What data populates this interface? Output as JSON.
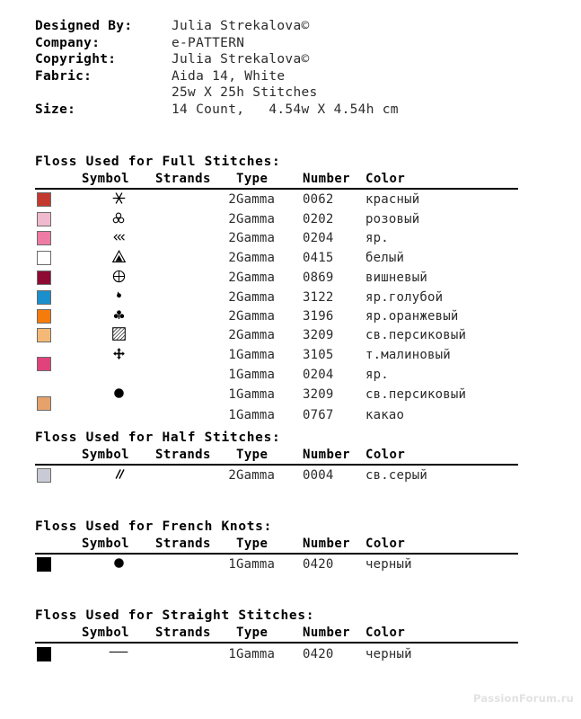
{
  "document": {
    "header": {
      "rows": [
        {
          "label": "Designed By:",
          "value": "Julia Strekalova©"
        },
        {
          "label": "Company:",
          "value": "e-PATTERN"
        },
        {
          "label": "Copyright:",
          "value": "Julia Strekalova©"
        },
        {
          "label": "Fabric:",
          "value": "Aida 14, White"
        },
        {
          "label": "",
          "value": "25w X 25h Stitches"
        },
        {
          "label": "Size:",
          "value": "14 Count,   4.54w X 4.54h cm"
        }
      ]
    },
    "columns": {
      "swatch": "",
      "symbol": "Symbol",
      "strands": "Strands",
      "type": "Type",
      "number": "Number",
      "color": "Color"
    },
    "sections": [
      {
        "id": "full-stitches",
        "title": "Floss Used for Full Stitches:",
        "rows": [
          {
            "swatch": "#C4392E",
            "symbol": "asterisk-six-icon",
            "strands": "2",
            "type": "Gamma",
            "number": "0062",
            "color": "красный"
          },
          {
            "swatch": "#EFB9CE",
            "symbol": "trefoil-icon",
            "strands": "2",
            "type": "Gamma",
            "number": "0202",
            "color": "розовый"
          },
          {
            "swatch": "#EE7BA3",
            "symbol": "triple-chevron-left-icon",
            "strands": "2",
            "type": "Gamma",
            "number": "0204",
            "color": "яр."
          },
          {
            "swatch": "#FFFFFF",
            "symbol": "triangle-nested-icon",
            "strands": "2",
            "type": "Gamma",
            "number": "0415",
            "color": "белый"
          },
          {
            "swatch": "#8E0B33",
            "symbol": "circled-plus-icon",
            "strands": "2",
            "type": "Gamma",
            "number": "0869",
            "color": "вишневый"
          },
          {
            "swatch": "#1B8FCC",
            "symbol": "comma-dot-icon",
            "strands": "2",
            "type": "Gamma",
            "number": "3122",
            "color": "яр.голубой"
          },
          {
            "swatch": "#F57C0A",
            "symbol": "club-filled-icon",
            "strands": "2",
            "type": "Gamma",
            "number": "3196",
            "color": "яр.оранжевый"
          },
          {
            "swatch": "#F5B977",
            "symbol": "hatched-square-icon",
            "strands": "2",
            "type": "Gamma",
            "number": "3209",
            "color": "св.персиковый"
          },
          {
            "swatch": "#E0437C",
            "swatch_shifted": true,
            "symbol": "four-way-arrow-icon",
            "strands": "1",
            "type": "Gamma",
            "number": "3105",
            "color": "т.малиновый"
          },
          {
            "swatch": "",
            "symbol": "",
            "strands": "1",
            "type": "Gamma",
            "number": "0204",
            "color": "яр."
          },
          {
            "swatch": "#E5A26B",
            "swatch_shifted": true,
            "symbol": "filled-circle-icon",
            "strands": "1",
            "type": "Gamma",
            "number": "3209",
            "color": "св.персиковый"
          },
          {
            "swatch": "",
            "symbol": "",
            "strands": "1",
            "type": "Gamma",
            "number": "0767",
            "color": "какао"
          }
        ]
      },
      {
        "id": "half-stitches",
        "title": "Floss Used for Half Stitches:",
        "rows": [
          {
            "swatch": "#C8CBD5",
            "symbol": "double-slash-icon",
            "strands": "2",
            "type": "Gamma",
            "number": "0004",
            "color": "св.серый"
          }
        ]
      },
      {
        "id": "french-knots",
        "title": "Floss Used for French Knots:",
        "rows": [
          {
            "swatch": "#000000",
            "symbol": "filled-circle-icon",
            "strands": "1",
            "type": "Gamma",
            "number": "0420",
            "color": "черный"
          }
        ]
      },
      {
        "id": "straight-stitches",
        "title": "Floss Used for Straight Stitches:",
        "rows": [
          {
            "swatch": "#000000",
            "symbol": "horizontal-line-icon",
            "strands": "1",
            "type": "Gamma",
            "number": "0420",
            "color": "черный"
          }
        ]
      }
    ],
    "watermark": "PassionForum.ru"
  }
}
